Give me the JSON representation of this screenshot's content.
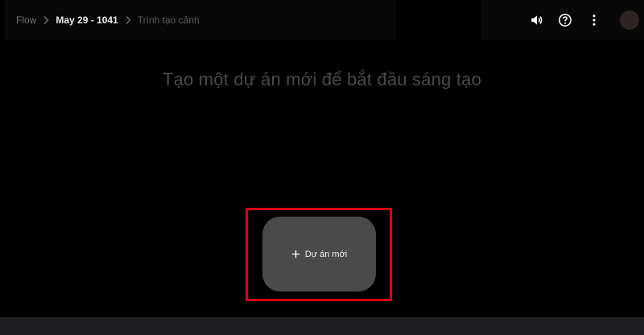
{
  "breadcrumb": {
    "items": [
      {
        "label": "Flow"
      },
      {
        "label": "May 29 - 1041"
      },
      {
        "label": "Trình tạo cảnh"
      }
    ]
  },
  "header": {
    "icons": [
      "volume-icon",
      "help-icon",
      "more-vert-icon",
      "avatar"
    ]
  },
  "main": {
    "heading": "Tạo một dự án mới để bắt đầu sáng tạo",
    "new_project_label": "Dự án mới"
  },
  "colors": {
    "background": "#000000",
    "card": "#4a4a4a",
    "highlight": "#e0000f",
    "heading_text": "#4a4a4a"
  }
}
